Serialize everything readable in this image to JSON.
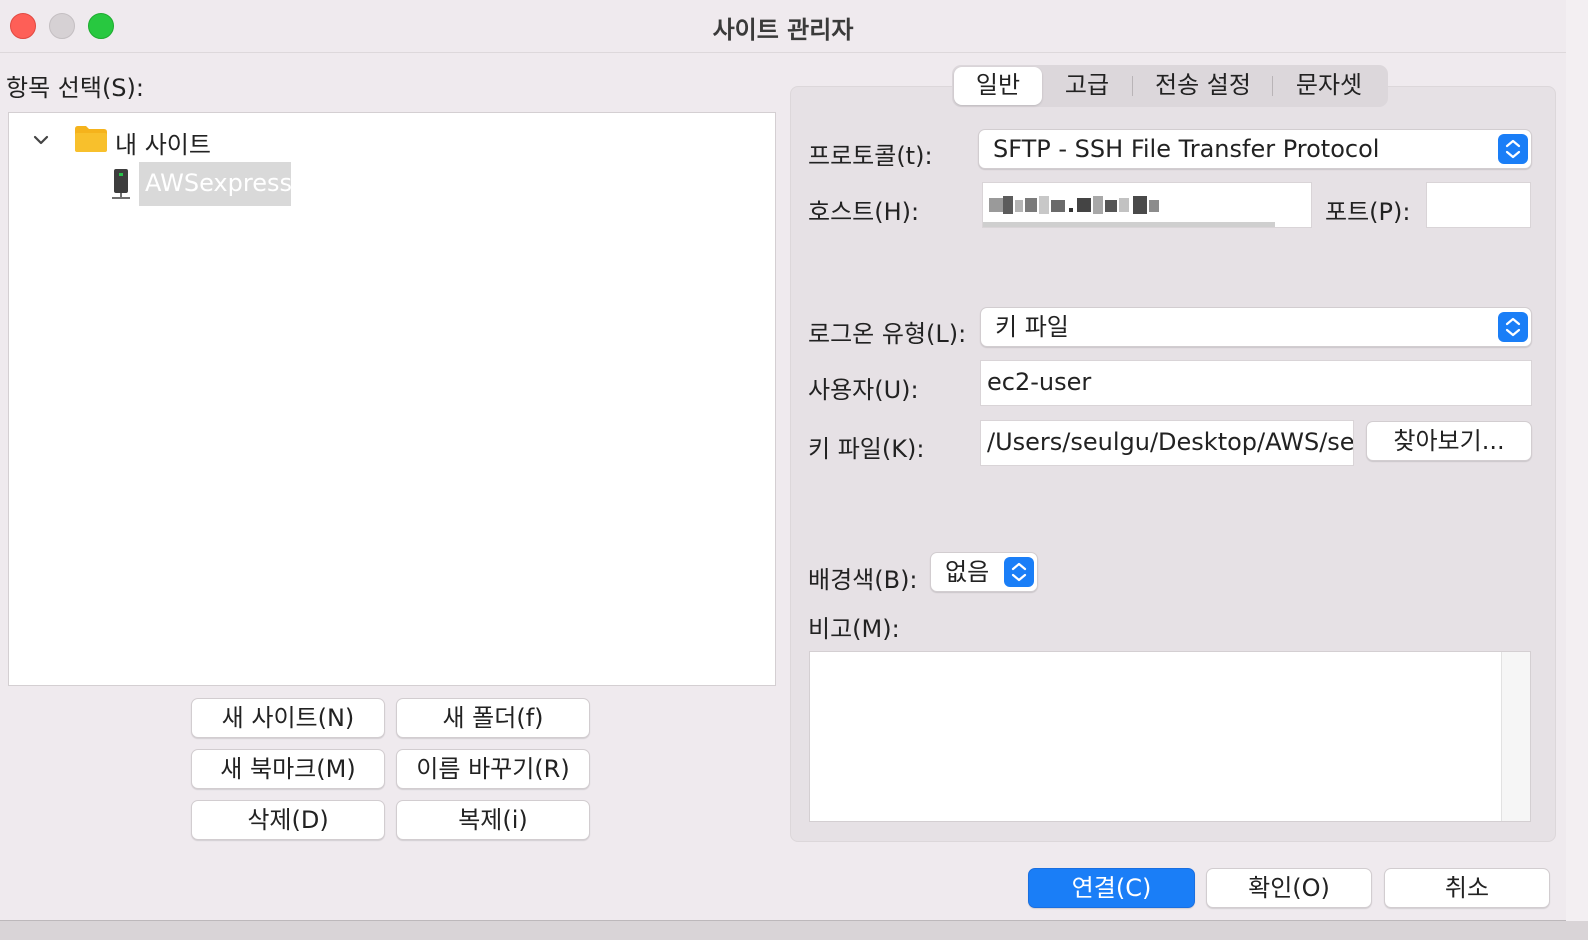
{
  "window": {
    "title": "사이트 관리자"
  },
  "left": {
    "select_label": "항목 선택(S):",
    "tree": {
      "folder_label": "내 사이트",
      "site_label": "AWSexpress"
    },
    "buttons": {
      "new_site": "새 사이트(N)",
      "new_folder": "새 폴더(f)",
      "new_bookmark": "새 북마크(M)",
      "rename": "이름 바꾸기(R)",
      "delete": "삭제(D)",
      "duplicate": "복제(i)"
    }
  },
  "tabs": [
    "일반",
    "고급",
    "전송 설정",
    "문자셋"
  ],
  "general": {
    "protocol_label": "프로토콜(t):",
    "protocol_value": "SFTP - SSH File Transfer Protocol",
    "host_label": "호스트(H):",
    "port_label": "포트(P):",
    "port_value": "",
    "logon_label": "로그온 유형(L):",
    "logon_value": "키 파일",
    "user_label": "사용자(U):",
    "user_value": "ec2-user",
    "keyfile_label": "키 파일(K):",
    "keyfile_value": "/Users/seulgu/Desktop/AWS/se",
    "browse_label": "찾아보기...",
    "bgcolor_label": "배경색(B):",
    "bgcolor_value": "없음",
    "memo_label": "비고(M):"
  },
  "footer": {
    "connect": "연결(C)",
    "ok": "확인(O)",
    "cancel": "취소"
  },
  "colors": {
    "accent": "#1a7ef7",
    "close": "#fe5f57",
    "minimize": "#d6d1d4",
    "zoom": "#28c840",
    "folder": "#f5b31c"
  }
}
